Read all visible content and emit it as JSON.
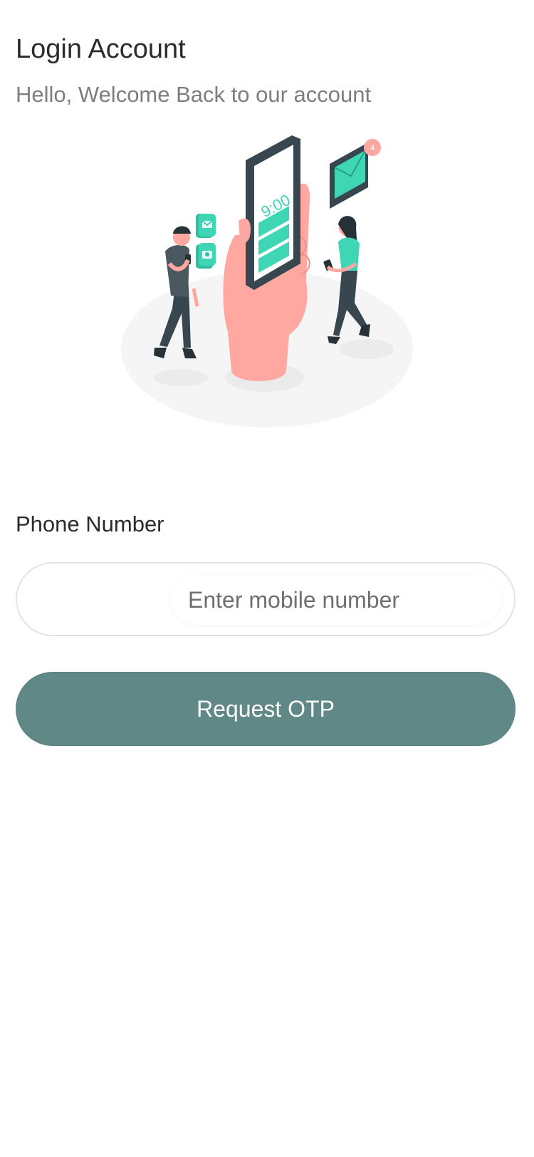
{
  "header": {
    "title": "Login Account",
    "subtitle": "Hello, Welcome Back to our account"
  },
  "illustration": {
    "name": "otp-login-illustration",
    "phone_time": "9:00",
    "notification_count": "4",
    "colors": {
      "accent": "#3fd6b6",
      "skin": "#ffa8a2",
      "dark": "#37464f",
      "platform": "#f5f5f5"
    }
  },
  "form": {
    "phone_label": "Phone Number",
    "phone_value": "",
    "phone_placeholder": "Enter mobile number",
    "submit_label": "Request OTP"
  },
  "theme": {
    "primary": "#5f8886",
    "text": "#2b2b2b",
    "muted": "#7e7e7e",
    "border": "#e3e3e3"
  }
}
